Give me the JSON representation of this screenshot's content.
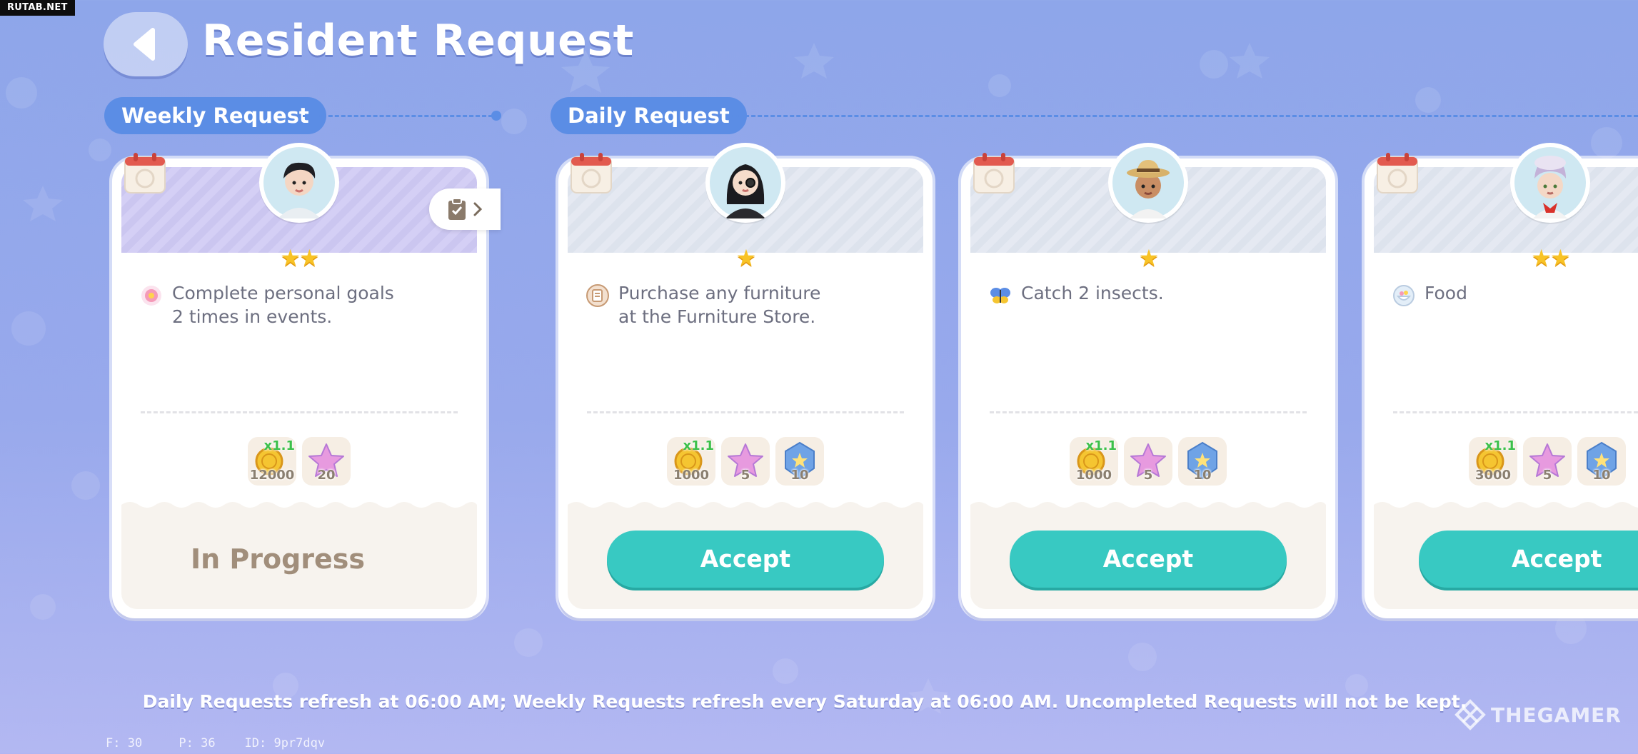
{
  "watermark_top": "RUTAB.NET",
  "header": {
    "title": "Resident Request"
  },
  "sections": {
    "weekly_label": "Weekly Request",
    "daily_label": "Daily Request"
  },
  "cards": [
    {
      "type": "weekly",
      "stars": 2,
      "stars_text": "★★",
      "task_lines": [
        "Complete personal goals",
        "2 times in events."
      ],
      "rewards": [
        {
          "icon": "gold-coin-icon",
          "qty": "12000",
          "mult": "x1.1"
        },
        {
          "icon": "pink-star-icon",
          "qty": "20"
        }
      ],
      "status": "In Progress"
    },
    {
      "type": "daily",
      "stars": 1,
      "stars_text": "★",
      "task_lines": [
        "Purchase any furniture",
        "at the Furniture Store."
      ],
      "rewards": [
        {
          "icon": "gold-coin-icon",
          "qty": "1000",
          "mult": "x1.1"
        },
        {
          "icon": "pink-star-icon",
          "qty": "5"
        },
        {
          "icon": "blue-badge-icon",
          "qty": "10"
        }
      ],
      "button": "Accept"
    },
    {
      "type": "daily",
      "stars": 1,
      "stars_text": "★",
      "task_lines": [
        "Catch 2 insects."
      ],
      "rewards": [
        {
          "icon": "gold-coin-icon",
          "qty": "1000",
          "mult": "x1.1"
        },
        {
          "icon": "pink-star-icon",
          "qty": "5"
        },
        {
          "icon": "blue-badge-icon",
          "qty": "10"
        }
      ],
      "button": "Accept"
    },
    {
      "type": "daily",
      "stars": 2,
      "stars_text": "★★",
      "task_lines": [
        "Food"
      ],
      "rewards": [
        {
          "icon": "gold-coin-icon",
          "qty": "3000",
          "mult": "x1.1"
        },
        {
          "icon": "pink-star-icon",
          "qty": "5"
        },
        {
          "icon": "blue-badge-icon",
          "qty": "10"
        }
      ],
      "button": "Accept"
    }
  ],
  "footer_note": "Daily Requests refresh at 06:00 AM; Weekly Requests refresh every Saturday at 06:00 AM. Uncompleted Requests will not be kept.",
  "thegamer_logo": "THEGAMER",
  "debug": {
    "f": "F: 30",
    "p": "P: 36",
    "id": "ID: 9pr7dqv"
  }
}
